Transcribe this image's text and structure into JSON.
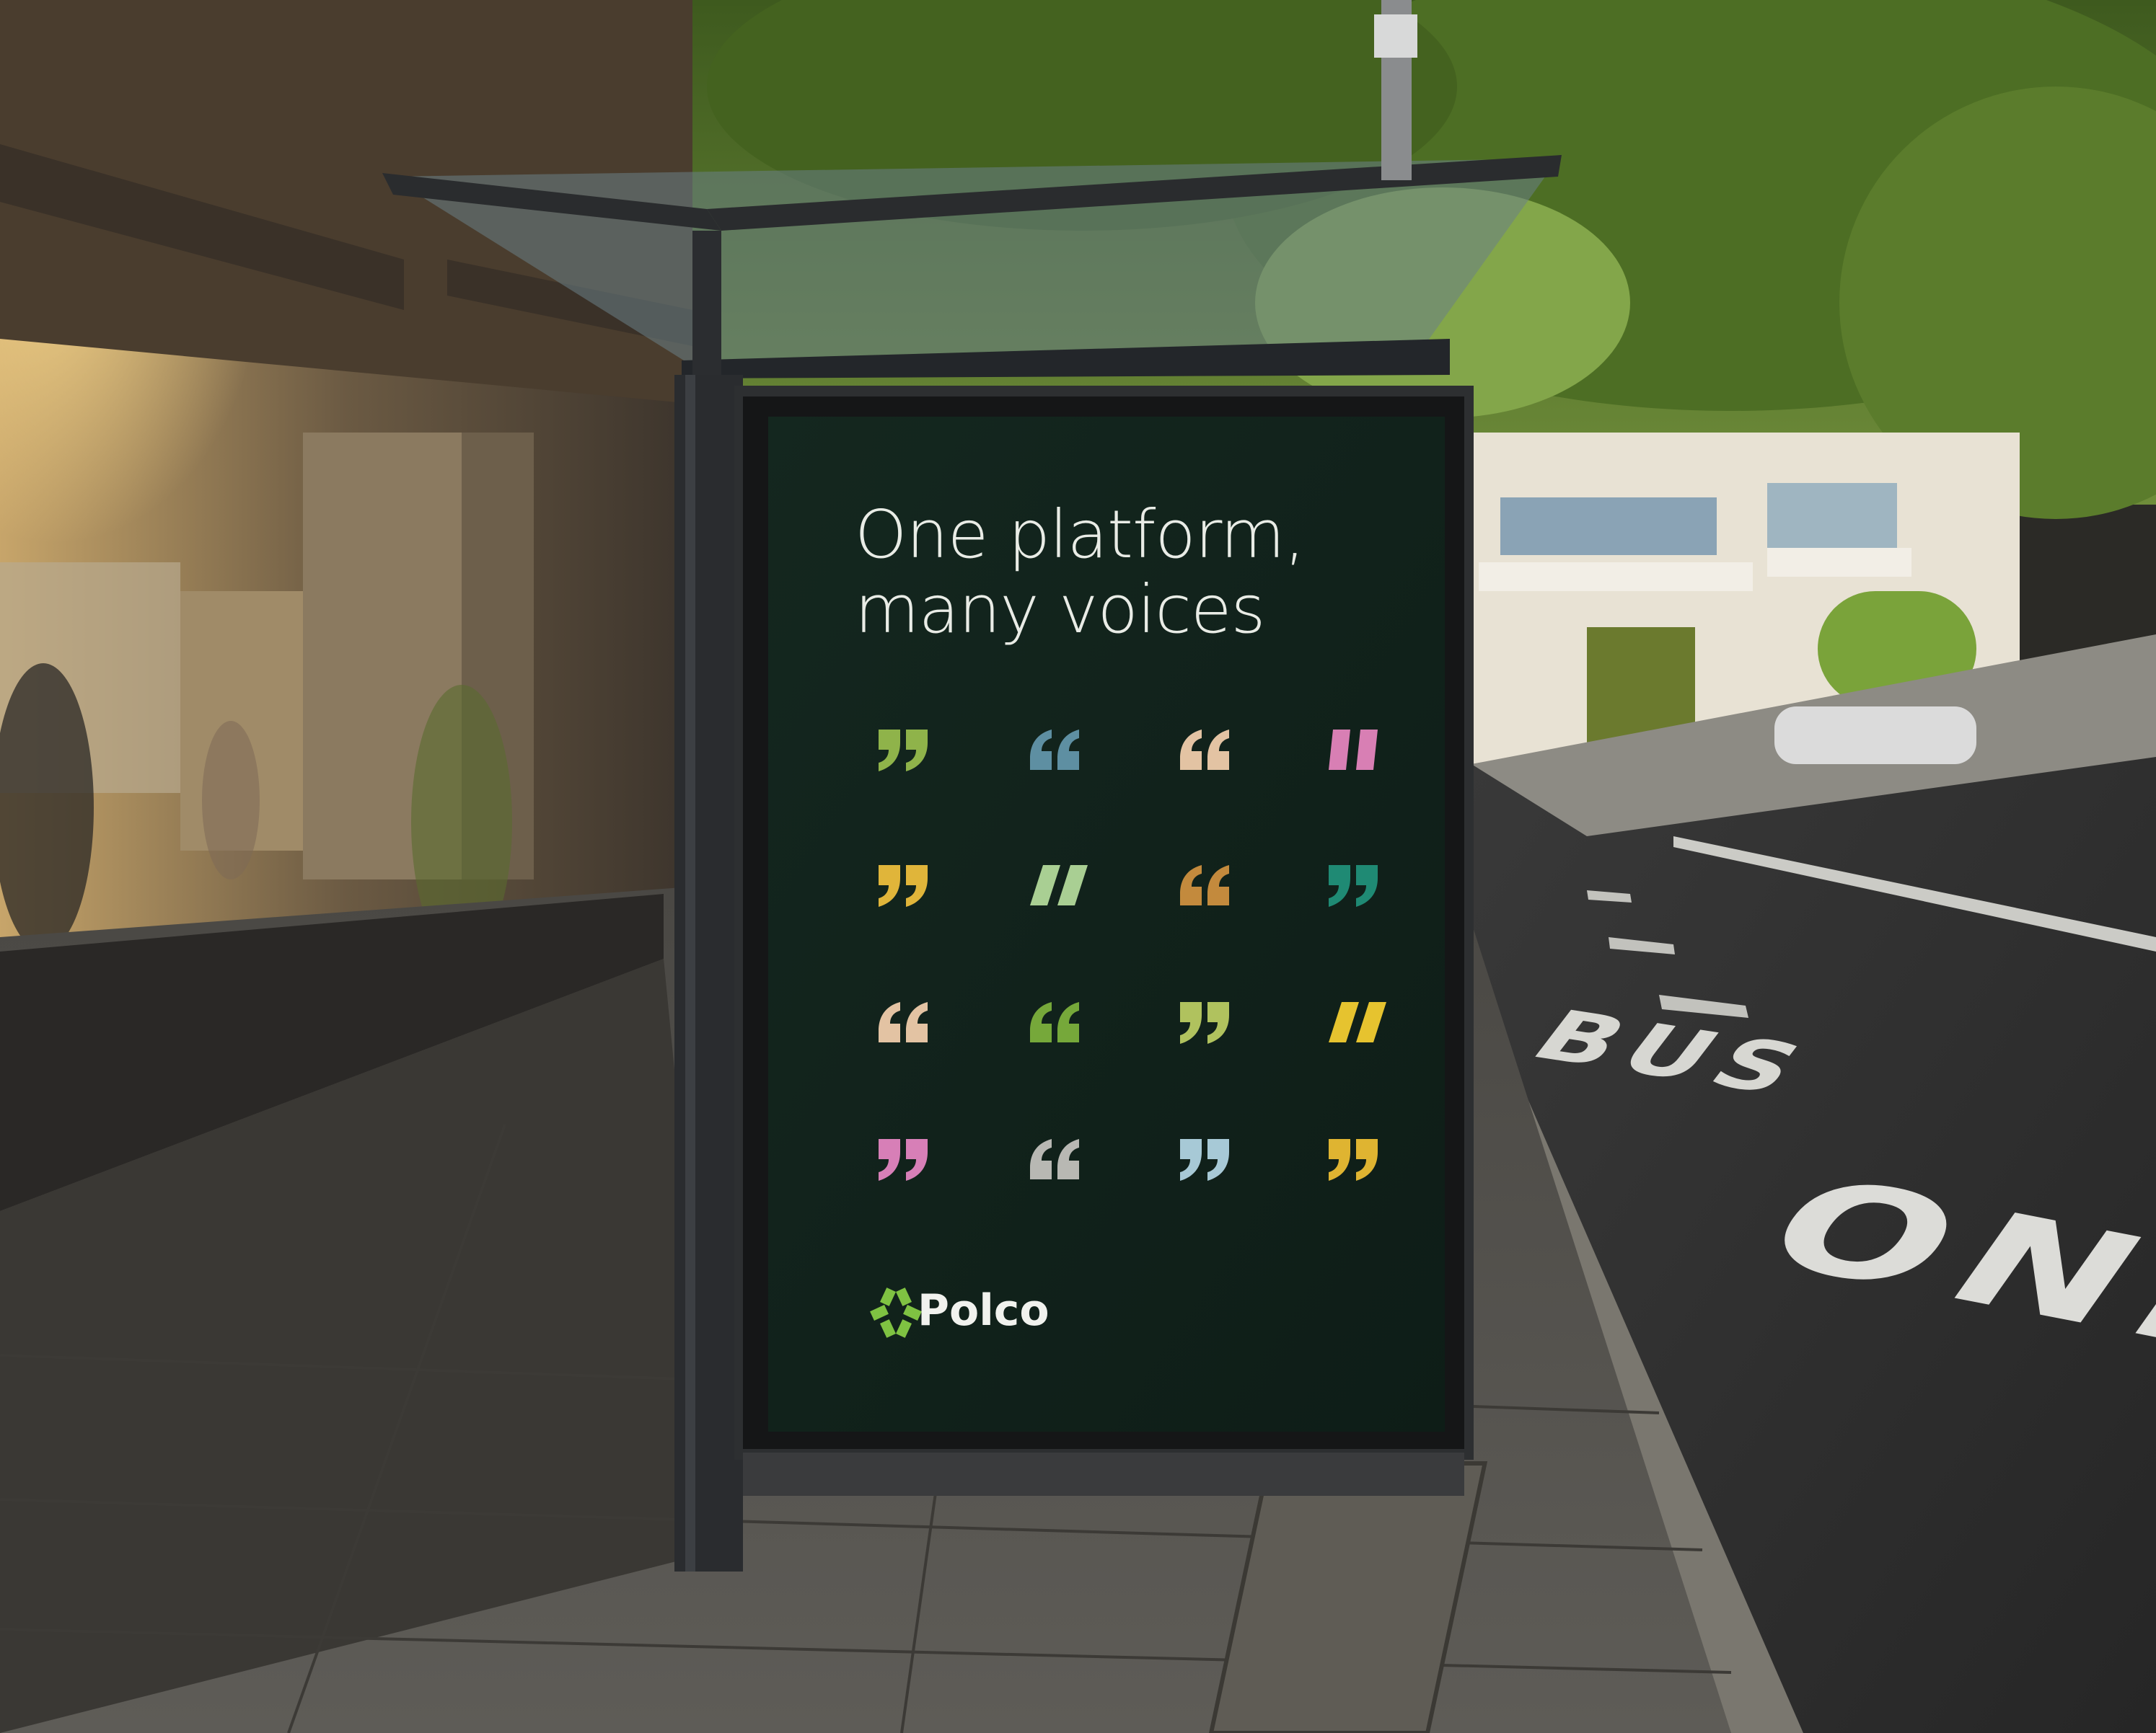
{
  "scene": {
    "description_kind": "bus shelter advertising poster mockup on city street"
  },
  "poster": {
    "headline_line1": "One platform,",
    "headline_line2": "many voices",
    "brand_name": "Polco",
    "background_color": "#11231c",
    "brand_mark_color": "#7fc242",
    "quote_colors": [
      "#8fb34a",
      "#5e8fa2",
      "#e3c3a3",
      "#d87fb4",
      "#e0b53a",
      "#a9cf93",
      "#c38a3d",
      "#1f8a74",
      "#e3c3a3",
      "#76a83a",
      "#b0c25e",
      "#e6c32f",
      "#d77fb7",
      "#b8b8b3",
      "#a7c9d6",
      "#dfb431"
    ]
  },
  "road": {
    "marking_bus": "BUS",
    "marking_only": "ONLY"
  }
}
